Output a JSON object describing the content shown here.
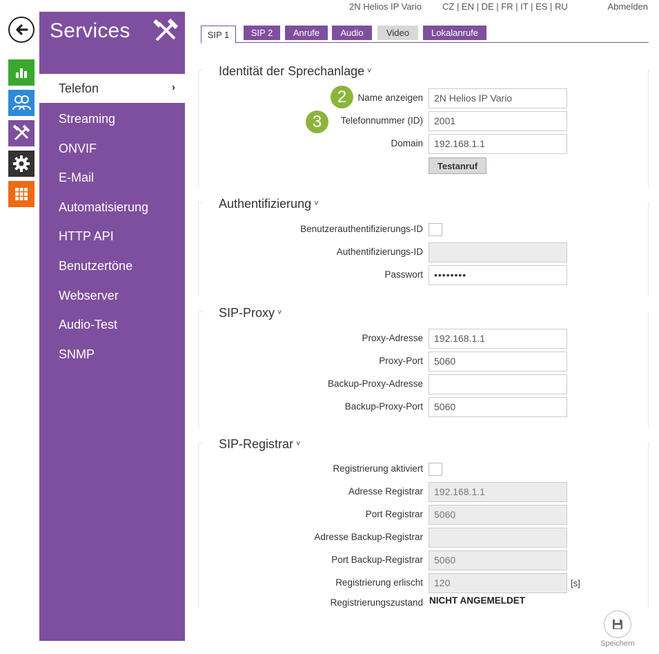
{
  "header": {
    "device_name": "2N Helios IP Vario",
    "languages": "CZ | EN | DE | FR | IT | ES | RU",
    "logout": "Abmelden"
  },
  "rail": {
    "icons": [
      "back-icon",
      "status-chart-icon",
      "users-icon",
      "services-tools-icon",
      "settings-gear-icon",
      "apps-grid-icon"
    ],
    "colors": {
      "status": "#3aa830",
      "users": "#2e8ad8",
      "services": "#7e4f9e",
      "settings": "#333333",
      "apps": "#ee6a14"
    }
  },
  "sidebar": {
    "title": "Services",
    "items": [
      {
        "label": "Telefon",
        "active": true
      },
      {
        "label": "Streaming"
      },
      {
        "label": "ONVIF"
      },
      {
        "label": "E-Mail"
      },
      {
        "label": "Automatisierung"
      },
      {
        "label": "HTTP API"
      },
      {
        "label": "Benutzertöne"
      },
      {
        "label": "Webserver"
      },
      {
        "label": "Audio-Test"
      },
      {
        "label": "SNMP"
      }
    ],
    "active_chevron": "›"
  },
  "tabs": [
    {
      "label": "SIP 1",
      "state": "active"
    },
    {
      "label": "SIP 2",
      "state": "purple"
    },
    {
      "label": "Anrufe",
      "state": "purple"
    },
    {
      "label": "Audio",
      "state": "purple"
    },
    {
      "label": "Video",
      "state": "gray"
    },
    {
      "label": "Lokalanrufe",
      "state": "purple"
    }
  ],
  "identity": {
    "title": "Identität der Sprechanlage",
    "caret": "˅",
    "badge_name": "2",
    "badge_phone": "3",
    "name_label": "Name anzeigen",
    "name_value": "2N Helios IP Vario",
    "phone_label": "Telefonnummer (ID)",
    "phone_value": "2001",
    "domain_label": "Domain",
    "domain_value": "192.168.1.1",
    "test_button": "Testanruf"
  },
  "auth": {
    "title": "Authentifizierung",
    "caret": "˅",
    "user_auth_label": "Benutzerauthentifizierungs-ID",
    "auth_id_label": "Authentifizierungs-ID",
    "auth_id_value": "",
    "password_label": "Passwort",
    "password_value": "••••••••"
  },
  "proxy": {
    "title": "SIP-Proxy",
    "caret": "˅",
    "address_label": "Proxy-Adresse",
    "address_value": "192.168.1.1",
    "port_label": "Proxy-Port",
    "port_value": "5060",
    "backup_address_label": "Backup-Proxy-Adresse",
    "backup_address_value": "",
    "backup_port_label": "Backup-Proxy-Port",
    "backup_port_value": "5060"
  },
  "registrar": {
    "title": "SIP-Registrar",
    "caret": "˅",
    "enabled_label": "Registrierung aktiviert",
    "address_label": "Adresse Registrar",
    "address_value": "192.168.1.1",
    "port_label": "Port Registrar",
    "port_value": "5060",
    "backup_address_label": "Adresse Backup-Registrar",
    "backup_address_value": "",
    "backup_port_label": "Port Backup-Registrar",
    "backup_port_value": "5060",
    "expiry_label": "Registrierung erlischt",
    "expiry_value": "120",
    "expiry_unit": "[s]",
    "state_label": "Registrierungszustand",
    "state_value": "NICHT ANGEMELDET"
  },
  "save": {
    "label": "Speichern"
  }
}
